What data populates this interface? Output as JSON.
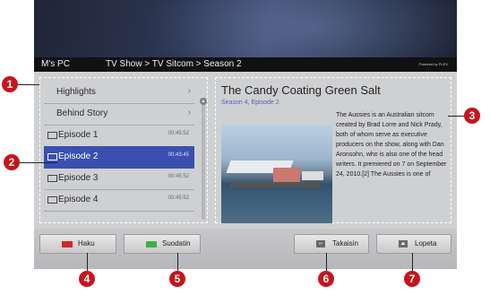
{
  "header": {
    "pc_name": "M's PC",
    "breadcrumb": "TV Show > TV Sitcom > Season 2",
    "brand": "Powered by PLEX"
  },
  "list": {
    "menu": [
      {
        "label": "Highlights",
        "chevron": "›"
      },
      {
        "label": "Behind Story",
        "chevron": "›"
      }
    ],
    "episodes": [
      {
        "label": "Episode 1",
        "duration": "00:45:52",
        "selected": false
      },
      {
        "label": "Episode 2",
        "duration": "00:43:45",
        "selected": true
      },
      {
        "label": "Episode 3",
        "duration": "00:45:52",
        "selected": false
      },
      {
        "label": "Episode 4",
        "duration": "00:45:52",
        "selected": false
      }
    ],
    "scroll_icon": "scroll-arrow-icon"
  },
  "detail": {
    "title": "The Candy Coating Green Salt",
    "subtitle": "Season 4, Episode 2",
    "description": "The Aussies is an Australian sitcom created by Brad Lorre and Nick Prady, both of whom serve as executive producers on the show, along with Dan Aronsohn, who is also one of the head writers. It premiered on 7 on September 24, 2010.[2] The Aussies is one of"
  },
  "buttons": {
    "haku": {
      "label": "Haku",
      "color": "#d6262c"
    },
    "suodatin": {
      "label": "Suodatin",
      "color": "#3cb043"
    },
    "takaisin": {
      "label": "Takaisin",
      "icon": "back-icon"
    },
    "lopeta": {
      "label": "Lopeta",
      "icon": "exit-icon"
    }
  },
  "callouts": [
    "1",
    "2",
    "3",
    "4",
    "5",
    "6",
    "7"
  ],
  "colors": {
    "selection": "#3a4fb0",
    "callout": "#c4161c"
  }
}
